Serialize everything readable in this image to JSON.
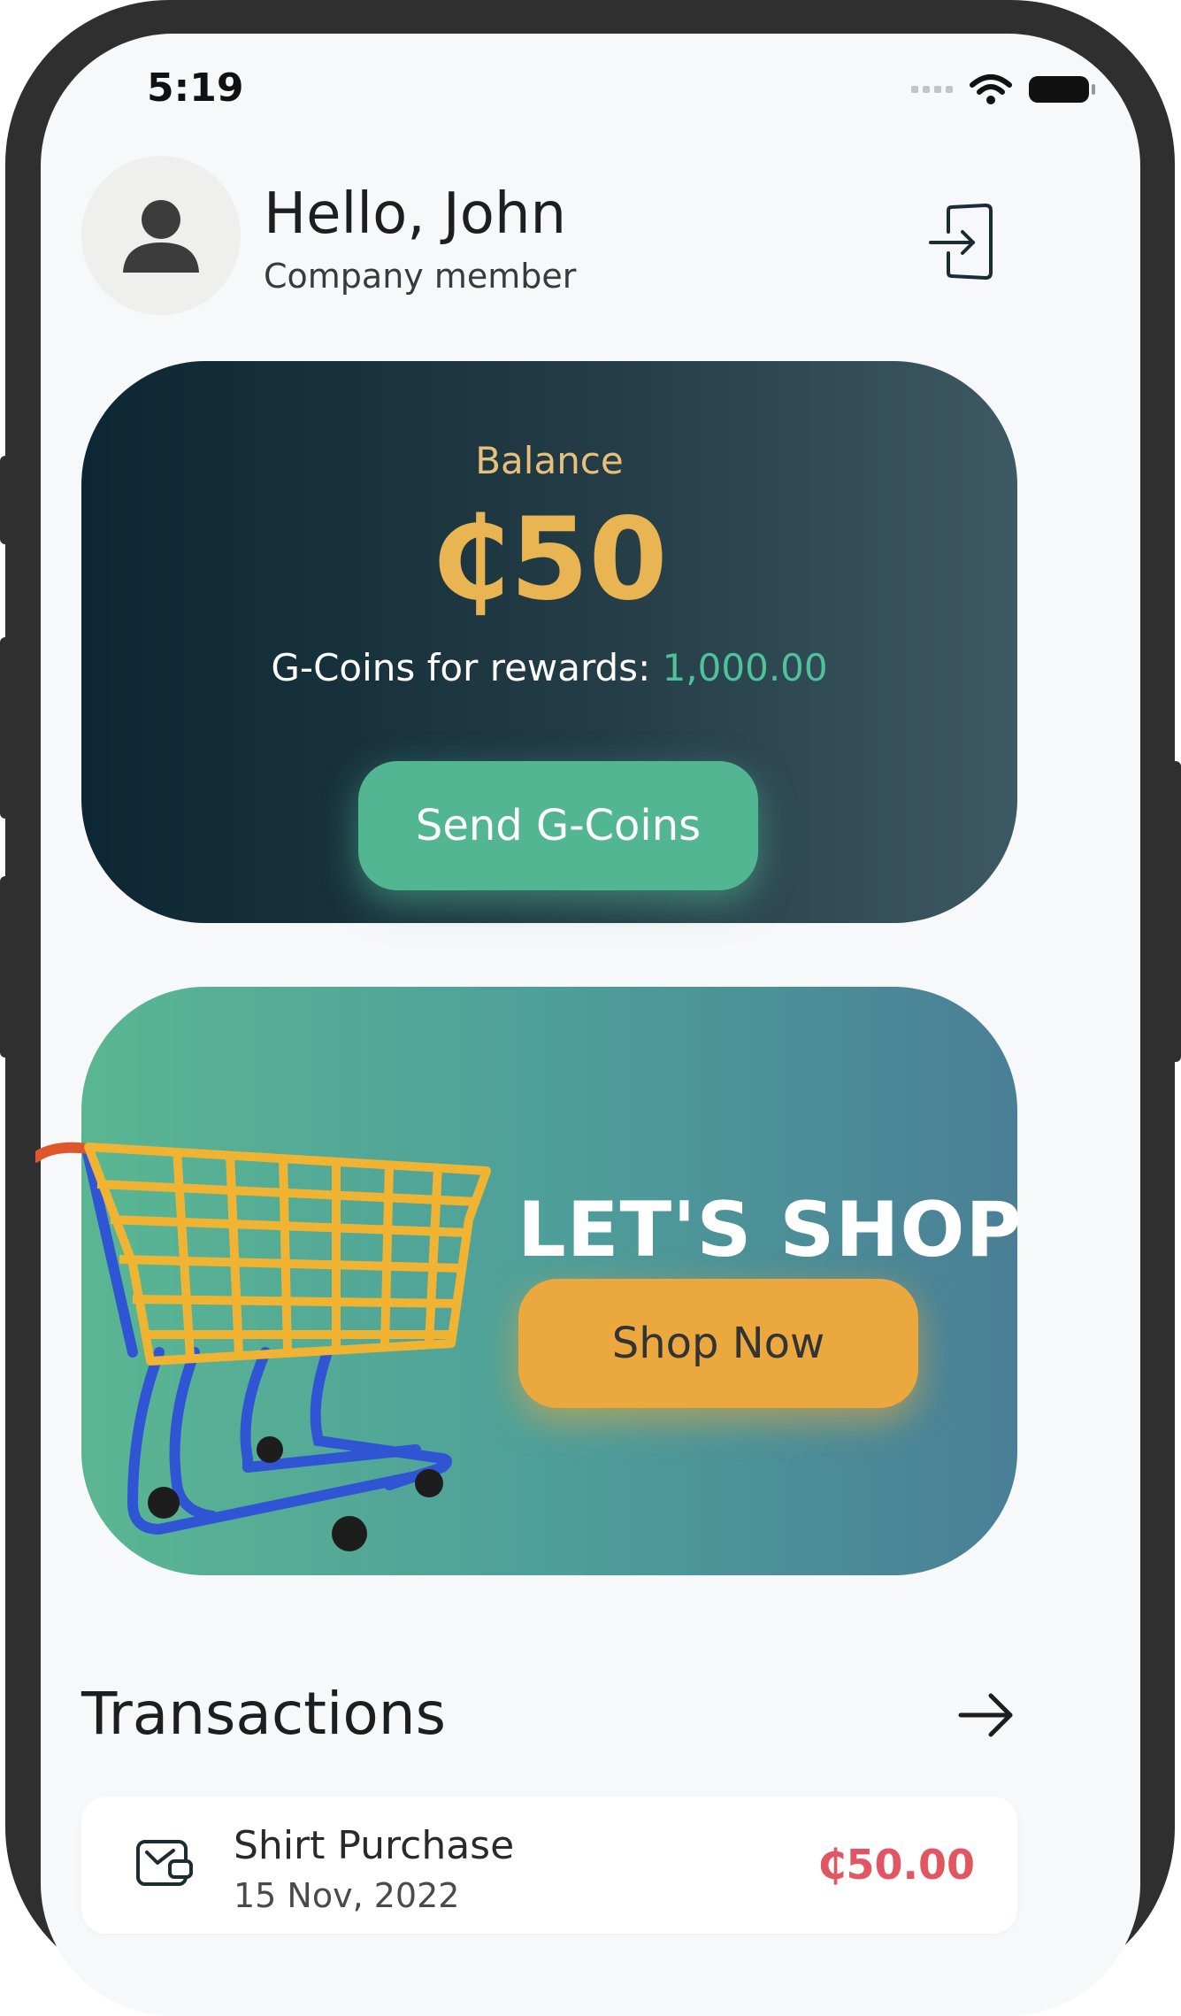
{
  "status_bar": {
    "time": "5:19"
  },
  "header": {
    "greeting": "Hello, John",
    "role": "Company member",
    "logout_icon": "logout-icon"
  },
  "balance": {
    "label": "Balance",
    "amount": "₵50",
    "rewards_label": "G-Coins for rewards: ",
    "rewards_value": "1,000.00",
    "send_label": "Send G-Coins"
  },
  "shop": {
    "title": "LET'S SHOP",
    "button_label": "Shop Now"
  },
  "transactions": {
    "title": "Transactions",
    "items": [
      {
        "name": "Shirt Purchase",
        "date": "15 Nov, 2022",
        "amount": "₵50.00"
      }
    ]
  },
  "colors": {
    "accent_green": "#53b692",
    "accent_gold": "#e9b452",
    "shop_orange": "#eaa83e",
    "negative_red": "#e25562"
  }
}
